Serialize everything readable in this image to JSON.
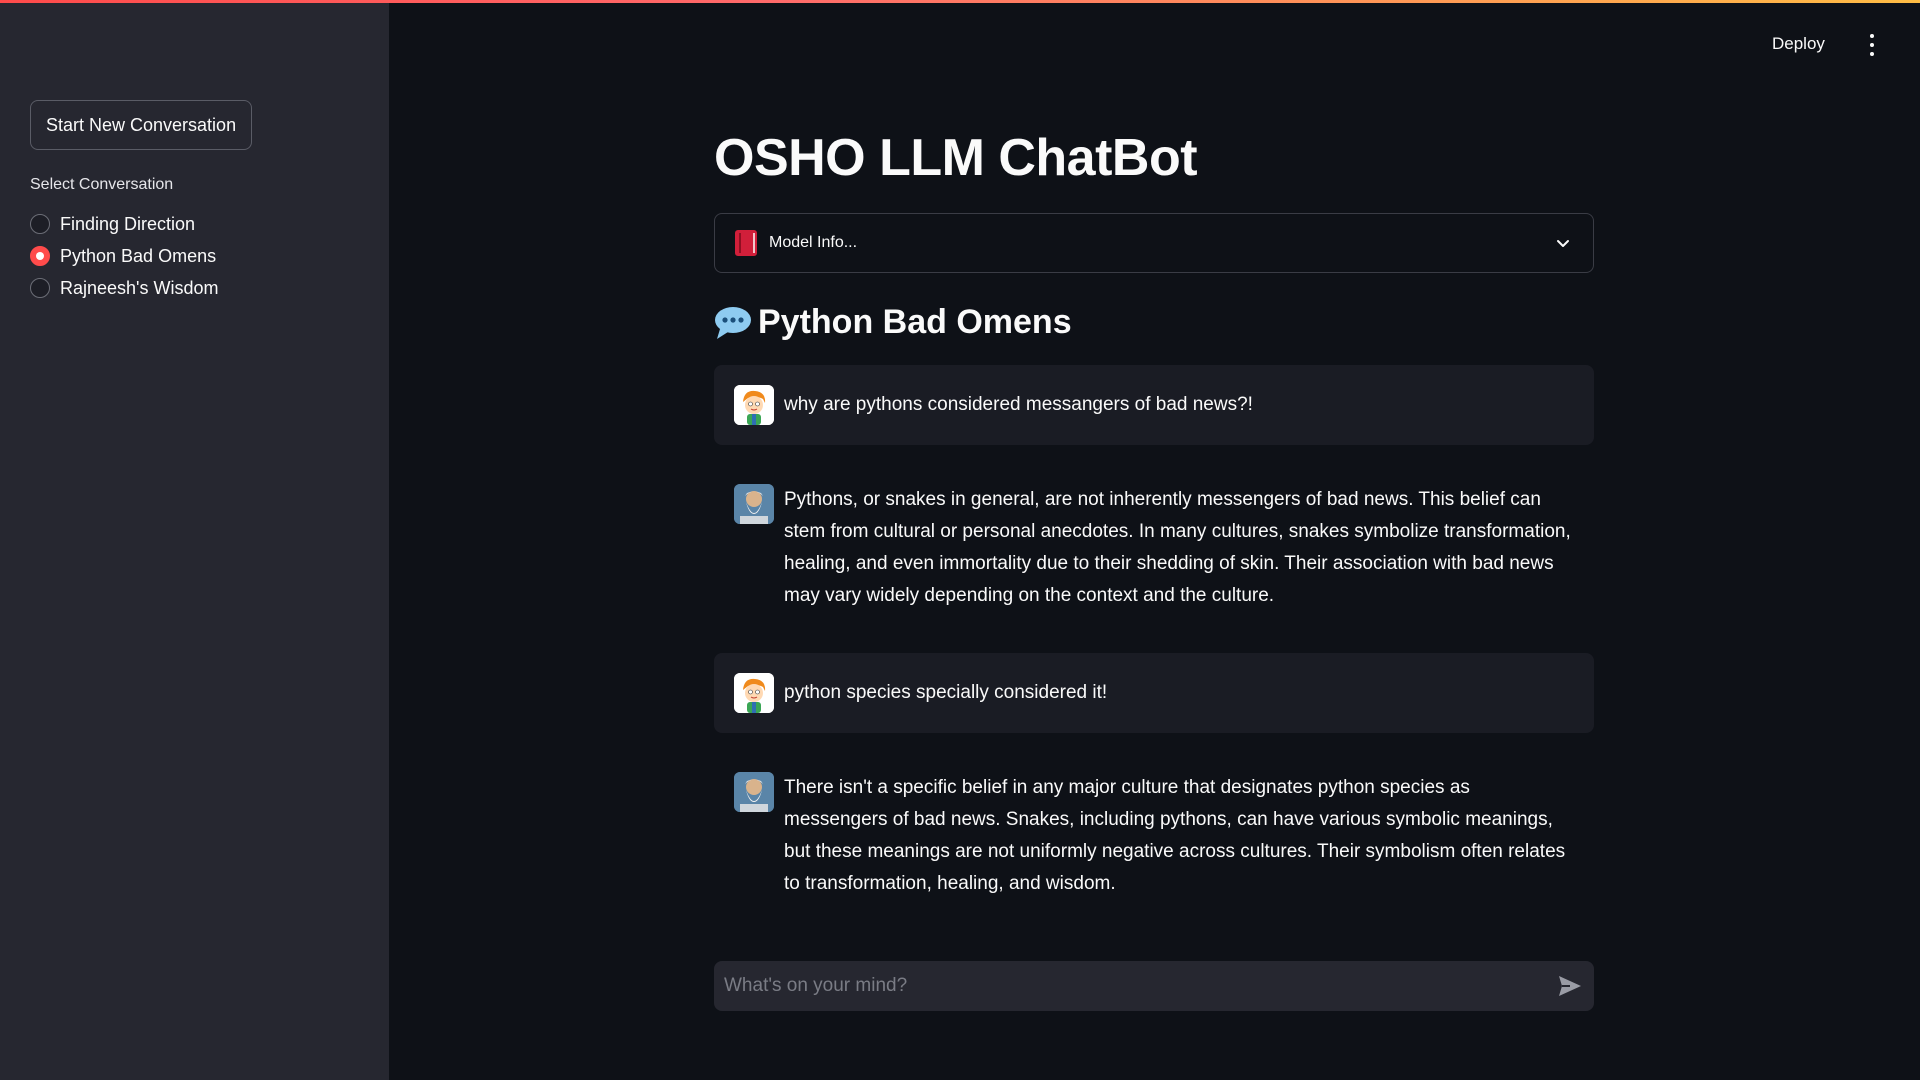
{
  "sidebar": {
    "new_conversation_label": "Start New Conversation",
    "select_label": "Select Conversation",
    "conversations": [
      {
        "label": "Finding Direction",
        "selected": false
      },
      {
        "label": "Python Bad Omens",
        "selected": true
      },
      {
        "label": "Rajneesh's Wisdom",
        "selected": false
      }
    ]
  },
  "header": {
    "deploy_label": "Deploy",
    "menu_icon": "vertical-ellipsis-icon"
  },
  "main": {
    "title": "OSHO LLM ChatBot",
    "expander": {
      "icon": "red-book-icon",
      "label": "Model Info...",
      "expanded": false
    },
    "conversation_title": "Python Bad Omens",
    "conversation_icon": "speech-balloon-icon",
    "messages": [
      {
        "role": "user",
        "text": "why are pythons considered messangers of bad news?!"
      },
      {
        "role": "assistant",
        "text": "Pythons, or snakes in general, are not inherently messengers of bad news. This belief can stem from cultural or personal anecdotes. In many cultures, snakes symbolize transformation, healing, and even immortality due to their shedding of skin. Their association with bad news may vary widely depending on the context and the culture."
      },
      {
        "role": "user",
        "text": "python species specially considered it!"
      },
      {
        "role": "assistant",
        "text": "There isn't a specific belief in any major culture that designates python species as messengers of bad news. Snakes, including pythons, can have various symbolic meanings, but these meanings are not uniformly negative across cultures. Their symbolism often relates to transformation, healing, and wisdom."
      }
    ]
  },
  "chat_input": {
    "placeholder": "What's on your mind?",
    "value": ""
  },
  "colors": {
    "accent": "#ff4b4b",
    "background": "#0e1117",
    "sidebar": "#262730"
  }
}
